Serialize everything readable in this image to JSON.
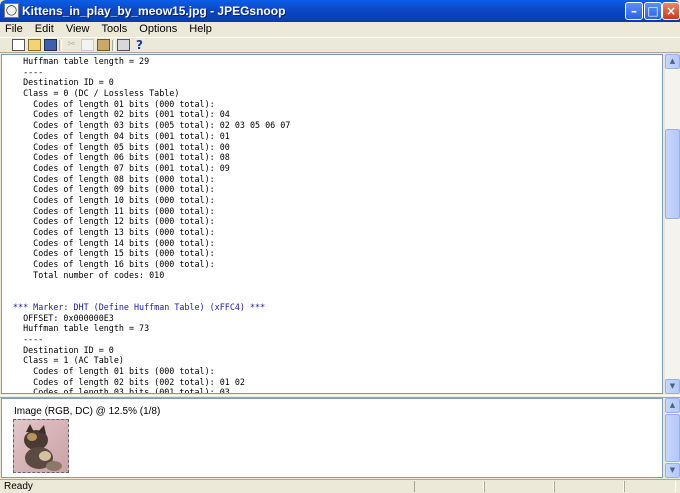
{
  "window": {
    "title": "Kittens_in_play_by_meow15.jpg - JPEGsnoop",
    "app_icon": "jpegsnoop-app-icon",
    "controls": [
      "minimize",
      "maximize",
      "close"
    ]
  },
  "menu": [
    "File",
    "Edit",
    "View",
    "Tools",
    "Options",
    "Help"
  ],
  "toolbar": [
    "new-file-icon",
    "open-folder-icon",
    "save-icon",
    "cut-icon",
    "copy-icon",
    "paste-icon",
    "print-icon",
    "help-icon"
  ],
  "log_lines": [
    {
      "text": "  Huffman table length = 29",
      "type": "normal"
    },
    {
      "text": "  ----",
      "type": "normal"
    },
    {
      "text": "  Destination ID = 0",
      "type": "normal"
    },
    {
      "text": "  Class = 0 (DC / Lossless Table)",
      "type": "normal"
    },
    {
      "text": "    Codes of length 01 bits (000 total):",
      "type": "normal"
    },
    {
      "text": "    Codes of length 02 bits (001 total): 04",
      "type": "normal"
    },
    {
      "text": "    Codes of length 03 bits (005 total): 02 03 05 06 07",
      "type": "normal"
    },
    {
      "text": "    Codes of length 04 bits (001 total): 01",
      "type": "normal"
    },
    {
      "text": "    Codes of length 05 bits (001 total): 00",
      "type": "normal"
    },
    {
      "text": "    Codes of length 06 bits (001 total): 08",
      "type": "normal"
    },
    {
      "text": "    Codes of length 07 bits (001 total): 09",
      "type": "normal"
    },
    {
      "text": "    Codes of length 08 bits (000 total):",
      "type": "normal"
    },
    {
      "text": "    Codes of length 09 bits (000 total):",
      "type": "normal"
    },
    {
      "text": "    Codes of length 10 bits (000 total):",
      "type": "normal"
    },
    {
      "text": "    Codes of length 11 bits (000 total):",
      "type": "normal"
    },
    {
      "text": "    Codes of length 12 bits (000 total):",
      "type": "normal"
    },
    {
      "text": "    Codes of length 13 bits (000 total):",
      "type": "normal"
    },
    {
      "text": "    Codes of length 14 bits (000 total):",
      "type": "normal"
    },
    {
      "text": "    Codes of length 15 bits (000 total):",
      "type": "normal"
    },
    {
      "text": "    Codes of length 16 bits (000 total):",
      "type": "normal"
    },
    {
      "text": "    Total number of codes: 010",
      "type": "normal"
    },
    {
      "text": "",
      "type": "normal"
    },
    {
      "text": "",
      "type": "normal"
    },
    {
      "text": "*** Marker: DHT (Define Huffman Table) (xFFC4) ***",
      "type": "marker"
    },
    {
      "text": "  OFFSET: 0x000000E3",
      "type": "normal"
    },
    {
      "text": "  Huffman table length = 73",
      "type": "normal"
    },
    {
      "text": "  ----",
      "type": "normal"
    },
    {
      "text": "  Destination ID = 0",
      "type": "normal"
    },
    {
      "text": "  Class = 1 (AC Table)",
      "type": "normal"
    },
    {
      "text": "    Codes of length 01 bits (000 total):",
      "type": "normal"
    },
    {
      "text": "    Codes of length 02 bits (002 total): 01 02",
      "type": "normal"
    },
    {
      "text": "    Codes of length 03 bits (001 total): 03",
      "type": "normal"
    }
  ],
  "image_pane": {
    "label": "Image (RGB, DC) @ 12.5% (1/8)"
  },
  "status": {
    "text": "Ready"
  }
}
